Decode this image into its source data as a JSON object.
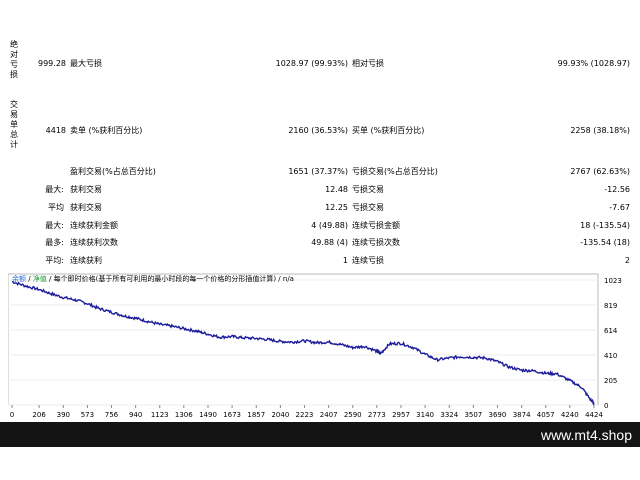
{
  "section_labels": {
    "absolute": "绝对亏损",
    "trades": "交易单总计"
  },
  "row1": {
    "value": "999.28",
    "max_loss_label": "最大亏损",
    "max_loss_value": "1028.97 (99.93%)",
    "rel_loss_label": "相对亏损",
    "rel_loss_value": "99.93% (1028.97)"
  },
  "row2": {
    "value": "4418",
    "short_label": "卖单 (%获利百分比)",
    "short_value": "2160 (36.53%)",
    "long_label": "买单 (%获利百分比)",
    "long_value": "2258 (38.18%)"
  },
  "stats": {
    "profit_trades_label": "盈利交易(%占总百分比)",
    "profit_trades_value": "1651 (37.37%)",
    "loss_trades_label": "亏损交易(%占总百分比)",
    "loss_trades_value": "2767 (62.63%)",
    "largest_prefix": "最大:",
    "largest_profit_label": "获利交易",
    "largest_profit_value": "12.48",
    "largest_loss_label": "亏损交易",
    "largest_loss_value": "-12.56",
    "average_prefix": "平均",
    "average_profit_label": "获利交易",
    "average_profit_value": "12.25",
    "average_loss_label": "亏损交易",
    "average_loss_value": "-7.67",
    "max_prefix": "最大:",
    "max_consec_win_label": "连续获利金额",
    "max_consec_win_value": "4 (49.88)",
    "max_consec_loss_label": "连续亏损金额",
    "max_consec_loss_value": "18 (-135.54)",
    "maximal_prefix": "最多:",
    "maximal_consec_profit_label": "连续获利次数",
    "maximal_consec_profit_value": "49.88 (4)",
    "maximal_consec_loss_label": "连续亏损次数",
    "maximal_consec_loss_value": "-135.54 (18)",
    "avg_prefix": "平均:",
    "avg_consec_wins_label": "连续获利",
    "avg_consec_wins_value": "1",
    "avg_consec_losses_label": "连续亏损",
    "avg_consec_losses_value": "2"
  },
  "legend": {
    "balance": "余额",
    "sep1": " / ",
    "equity": "净值",
    "rest": " / 每个即时价格(基于所有可利用的最小时段的每一个价格的分形插值计算) / n/a"
  },
  "colors": {
    "line": "#1c1c9c",
    "grid": "#d8d8d8",
    "footer_bg": "#141414"
  },
  "footer": {
    "brand": "www.mt4.shop"
  },
  "chart_data": {
    "type": "line",
    "x_ticks": [
      "0",
      "206",
      "390",
      "573",
      "756",
      "940",
      "1123",
      "1306",
      "1490",
      "1673",
      "1857",
      "2040",
      "2223",
      "2407",
      "2590",
      "2773",
      "2957",
      "3140",
      "3324",
      "3507",
      "3690",
      "3874",
      "4057",
      "4240",
      "4424"
    ],
    "y_ticks": [
      "1023",
      "819",
      "614",
      "410",
      "205",
      "0"
    ],
    "xlim": [
      0,
      4424
    ],
    "ylim": [
      0,
      1023
    ],
    "series": [
      {
        "x": [
          0,
          100,
          206,
          300,
          390,
          480,
          573,
          660,
          756,
          850,
          940,
          1030,
          1123,
          1215,
          1306,
          1400,
          1490,
          1580,
          1673,
          1760,
          1857,
          1950,
          2040,
          2130,
          2223,
          2315,
          2407,
          2500,
          2590,
          2680,
          2773,
          2800,
          2870,
          2957,
          3050,
          3140,
          3230,
          3324,
          3410,
          3507,
          3600,
          3690,
          3780,
          3874,
          3960,
          4057,
          4140,
          4240,
          4330,
          4400,
          4424
        ],
        "y": [
          1010,
          975,
          945,
          910,
          880,
          860,
          830,
          790,
          760,
          730,
          710,
          685,
          660,
          645,
          625,
          605,
          580,
          555,
          560,
          550,
          545,
          535,
          520,
          515,
          525,
          510,
          515,
          495,
          470,
          480,
          440,
          420,
          500,
          505,
          470,
          415,
          370,
          385,
          395,
          390,
          385,
          355,
          310,
          285,
          280,
          260,
          255,
          200,
          145,
          40,
          15
        ]
      }
    ]
  }
}
